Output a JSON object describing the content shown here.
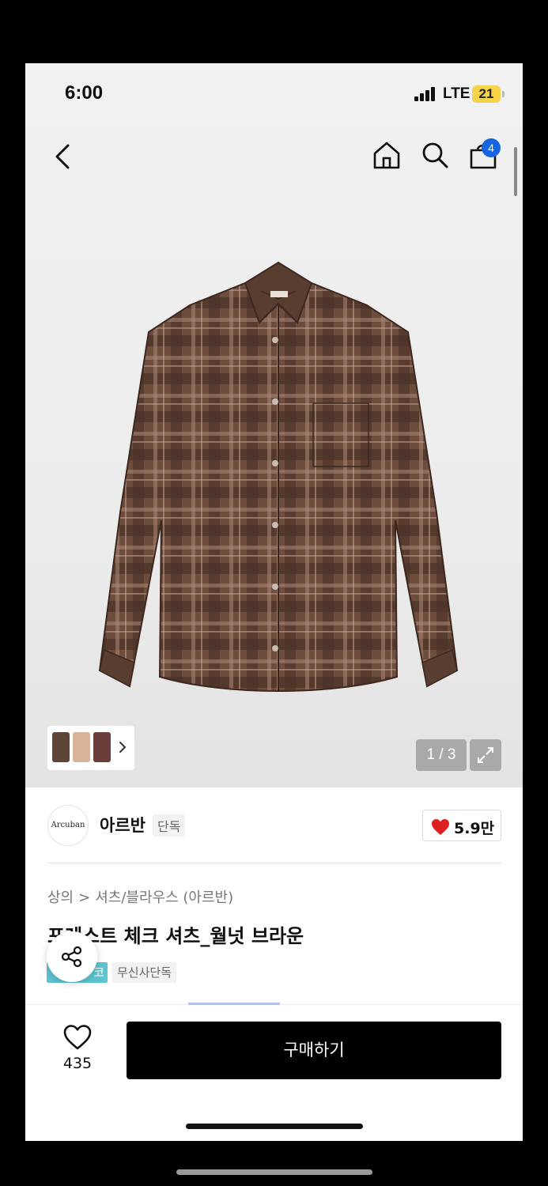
{
  "status_bar": {
    "time": "6:00",
    "network": "LTE",
    "battery": "21"
  },
  "header": {
    "cart_count": "4"
  },
  "gallery": {
    "page_indicator": "1 / 3",
    "thumbnail_colors": [
      "#5e4536",
      "#d9b29a",
      "#6a3c3a"
    ]
  },
  "brand": {
    "logo_text": "Arcuban",
    "name": "아르반",
    "tag": "단독",
    "likes": "5.9만"
  },
  "breadcrumb": [
    "상의",
    ">",
    "셔츠/블라우스 (아르반)"
  ],
  "product": {
    "title": "포레스트 체크 셔츠_월넛 브라운",
    "tag_cyan": "코",
    "tag_exclusive": "무신사단독"
  },
  "bottom_bar": {
    "wish_count": "435",
    "buy_label": "구매하기"
  },
  "colors": {
    "accent_blue": "#1565e0",
    "heart_red": "#e02020",
    "tag_cyan": "#5cc4cf",
    "shirt_brown": "#6d4d3e"
  }
}
